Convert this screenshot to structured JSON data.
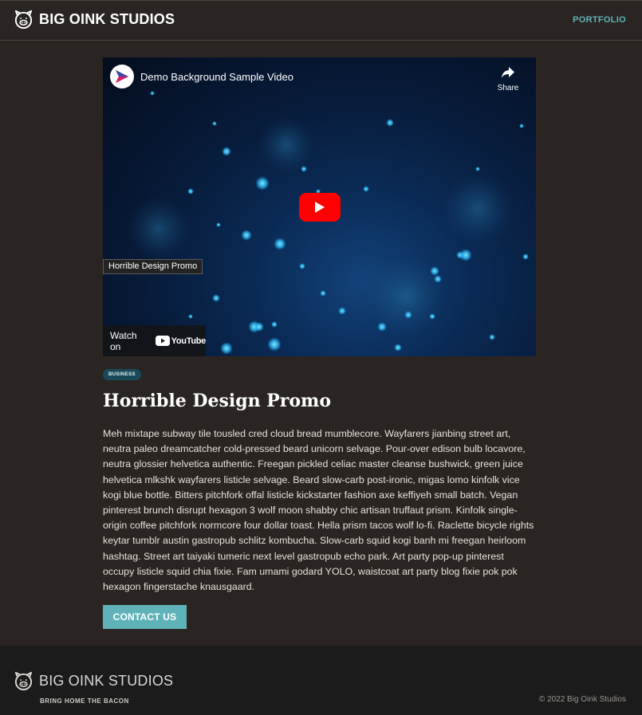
{
  "header": {
    "brand": "BIG OINK STUDIOS",
    "nav_portfolio": "PORTFOLIO"
  },
  "video": {
    "title": "Demo Background Sample Video",
    "share_label": "Share",
    "tooltip": "Horrible Design Promo",
    "watch_on": "Watch on",
    "youtube_word": "YouTube"
  },
  "post": {
    "category": "BUSINESS",
    "title": "Horrible Design Promo",
    "body": "Meh mixtape subway tile tousled cred cloud bread mumblecore. Wayfarers jianbing street art, neutra paleo dreamcatcher cold-pressed beard unicorn selvage. Pour-over edison bulb locavore, neutra glossier helvetica authentic. Freegan pickled celiac master cleanse bushwick, green juice helvetica mlkshk wayfarers listicle selvage. Beard slow-carb post-ironic, migas lomo kinfolk vice kogi blue bottle. Bitters pitchfork offal listicle kickstarter fashion axe keffiyeh small batch. Vegan pinterest brunch disrupt hexagon 3 wolf moon shabby chic artisan truffaut prism. Kinfolk single-origin coffee pitchfork normcore four dollar toast. Hella prism tacos wolf lo-fi. Raclette bicycle rights keytar tumblr austin gastropub schlitz kombucha. Slow-carb squid kogi banh mi freegan heirloom hashtag. Street art taiyaki tumeric next level gastropub echo park. Art party pop-up pinterest occupy listicle squid chia fixie. Fam umami godard YOLO, waistcoat art party blog fixie pok pok hexagon fingerstache knausgaard.",
    "cta": "CONTACT US"
  },
  "footer": {
    "brand": "BIG OINK STUDIOS",
    "tagline": "BRING HOME THE BACON",
    "copyright": "© 2022 Big Oink Studios"
  },
  "colors": {
    "background": "#2a2522",
    "accent": "#5fb3b8",
    "footer": "#1b1b1b",
    "badge": "#1a4a5a"
  },
  "icons": [
    "pig-logo-icon",
    "share-icon",
    "play-icon",
    "youtube-logo-icon"
  ]
}
